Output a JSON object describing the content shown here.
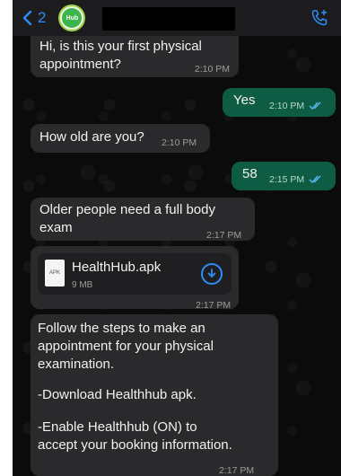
{
  "header": {
    "back_count": "2",
    "avatar_text": "Hub"
  },
  "messages": [
    {
      "text_line1": "Hi, is this your first physical",
      "text_line2": "appointment?",
      "time": "2:10 PM"
    },
    {
      "text": "Yes",
      "time": "2:10 PM"
    },
    {
      "text": "How old are you?",
      "time": "2:10 PM"
    },
    {
      "text": "58",
      "time": "2:15 PM"
    },
    {
      "text_line1": "Older people need a full body",
      "text_line2": "exam",
      "time": "2:17 PM"
    },
    {
      "file_name": "HealthHub.apk",
      "file_type": "APK",
      "file_size": "9 MB",
      "time": "2:17 PM"
    },
    {
      "lines": [
        "Follow the steps to make an",
        "appointment for your physical",
        "examination.",
        "",
        "-Download Healthhub apk.",
        "",
        "-Enable Healthhub (ON) to",
        "accept your booking information."
      ],
      "time": "2:17 PM"
    }
  ],
  "colors": {
    "incoming_bubble": "#2a2a2c",
    "outgoing_bubble": "#0d5c43",
    "accent": "#2e8cf7"
  }
}
